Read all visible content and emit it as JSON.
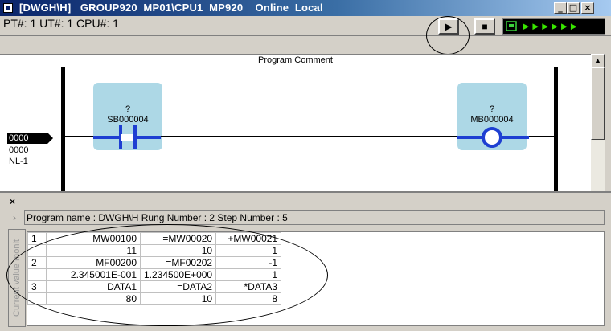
{
  "window": {
    "title": "[DWGH\\H]   GROUP920  MP01\\CPU1  MP920    Online  Local",
    "minimize_glyph": "_",
    "maximize_glyph": "□",
    "close_glyph": "×"
  },
  "toolbar": {
    "status": "PT#: 1 UT#: 1 CPU#: 1",
    "play_glyph": "▶",
    "stop_glyph": "■",
    "monitor_arrows": "►►►►►►"
  },
  "ladder": {
    "comment": "Program Comment",
    "rung_tag": "0000",
    "rung_step": "0000",
    "rung_nl": "NL-1",
    "contact": {
      "comment": "?",
      "address": "SB000004"
    },
    "coil": {
      "comment": "?",
      "address": "MB000004"
    }
  },
  "scrollbar": {
    "up_glyph": "▲"
  },
  "lower": {
    "close_glyph": "×",
    "info_arrow": "›",
    "info_text": "Program name : DWGH\\H Rung Number : 2 Step Number : 5",
    "side_tab": "Current value monit",
    "rows": [
      [
        "1",
        "MW00100",
        "=MW00020",
        "+MW00021"
      ],
      [
        "",
        "11",
        "10",
        "1"
      ],
      [
        "2",
        "MF00200",
        "=MF00202",
        "-1"
      ],
      [
        "",
        "2.345001E-001",
        "1.234500E+000",
        "1"
      ],
      [
        "3",
        "DATA1",
        "=DATA2",
        "*DATA3"
      ],
      [
        "",
        "80",
        "10",
        "8"
      ]
    ]
  },
  "colors": {
    "titlebar": "#0a246a",
    "contact_box": "#add8e6",
    "rung_blue": "#1e3fd2"
  }
}
